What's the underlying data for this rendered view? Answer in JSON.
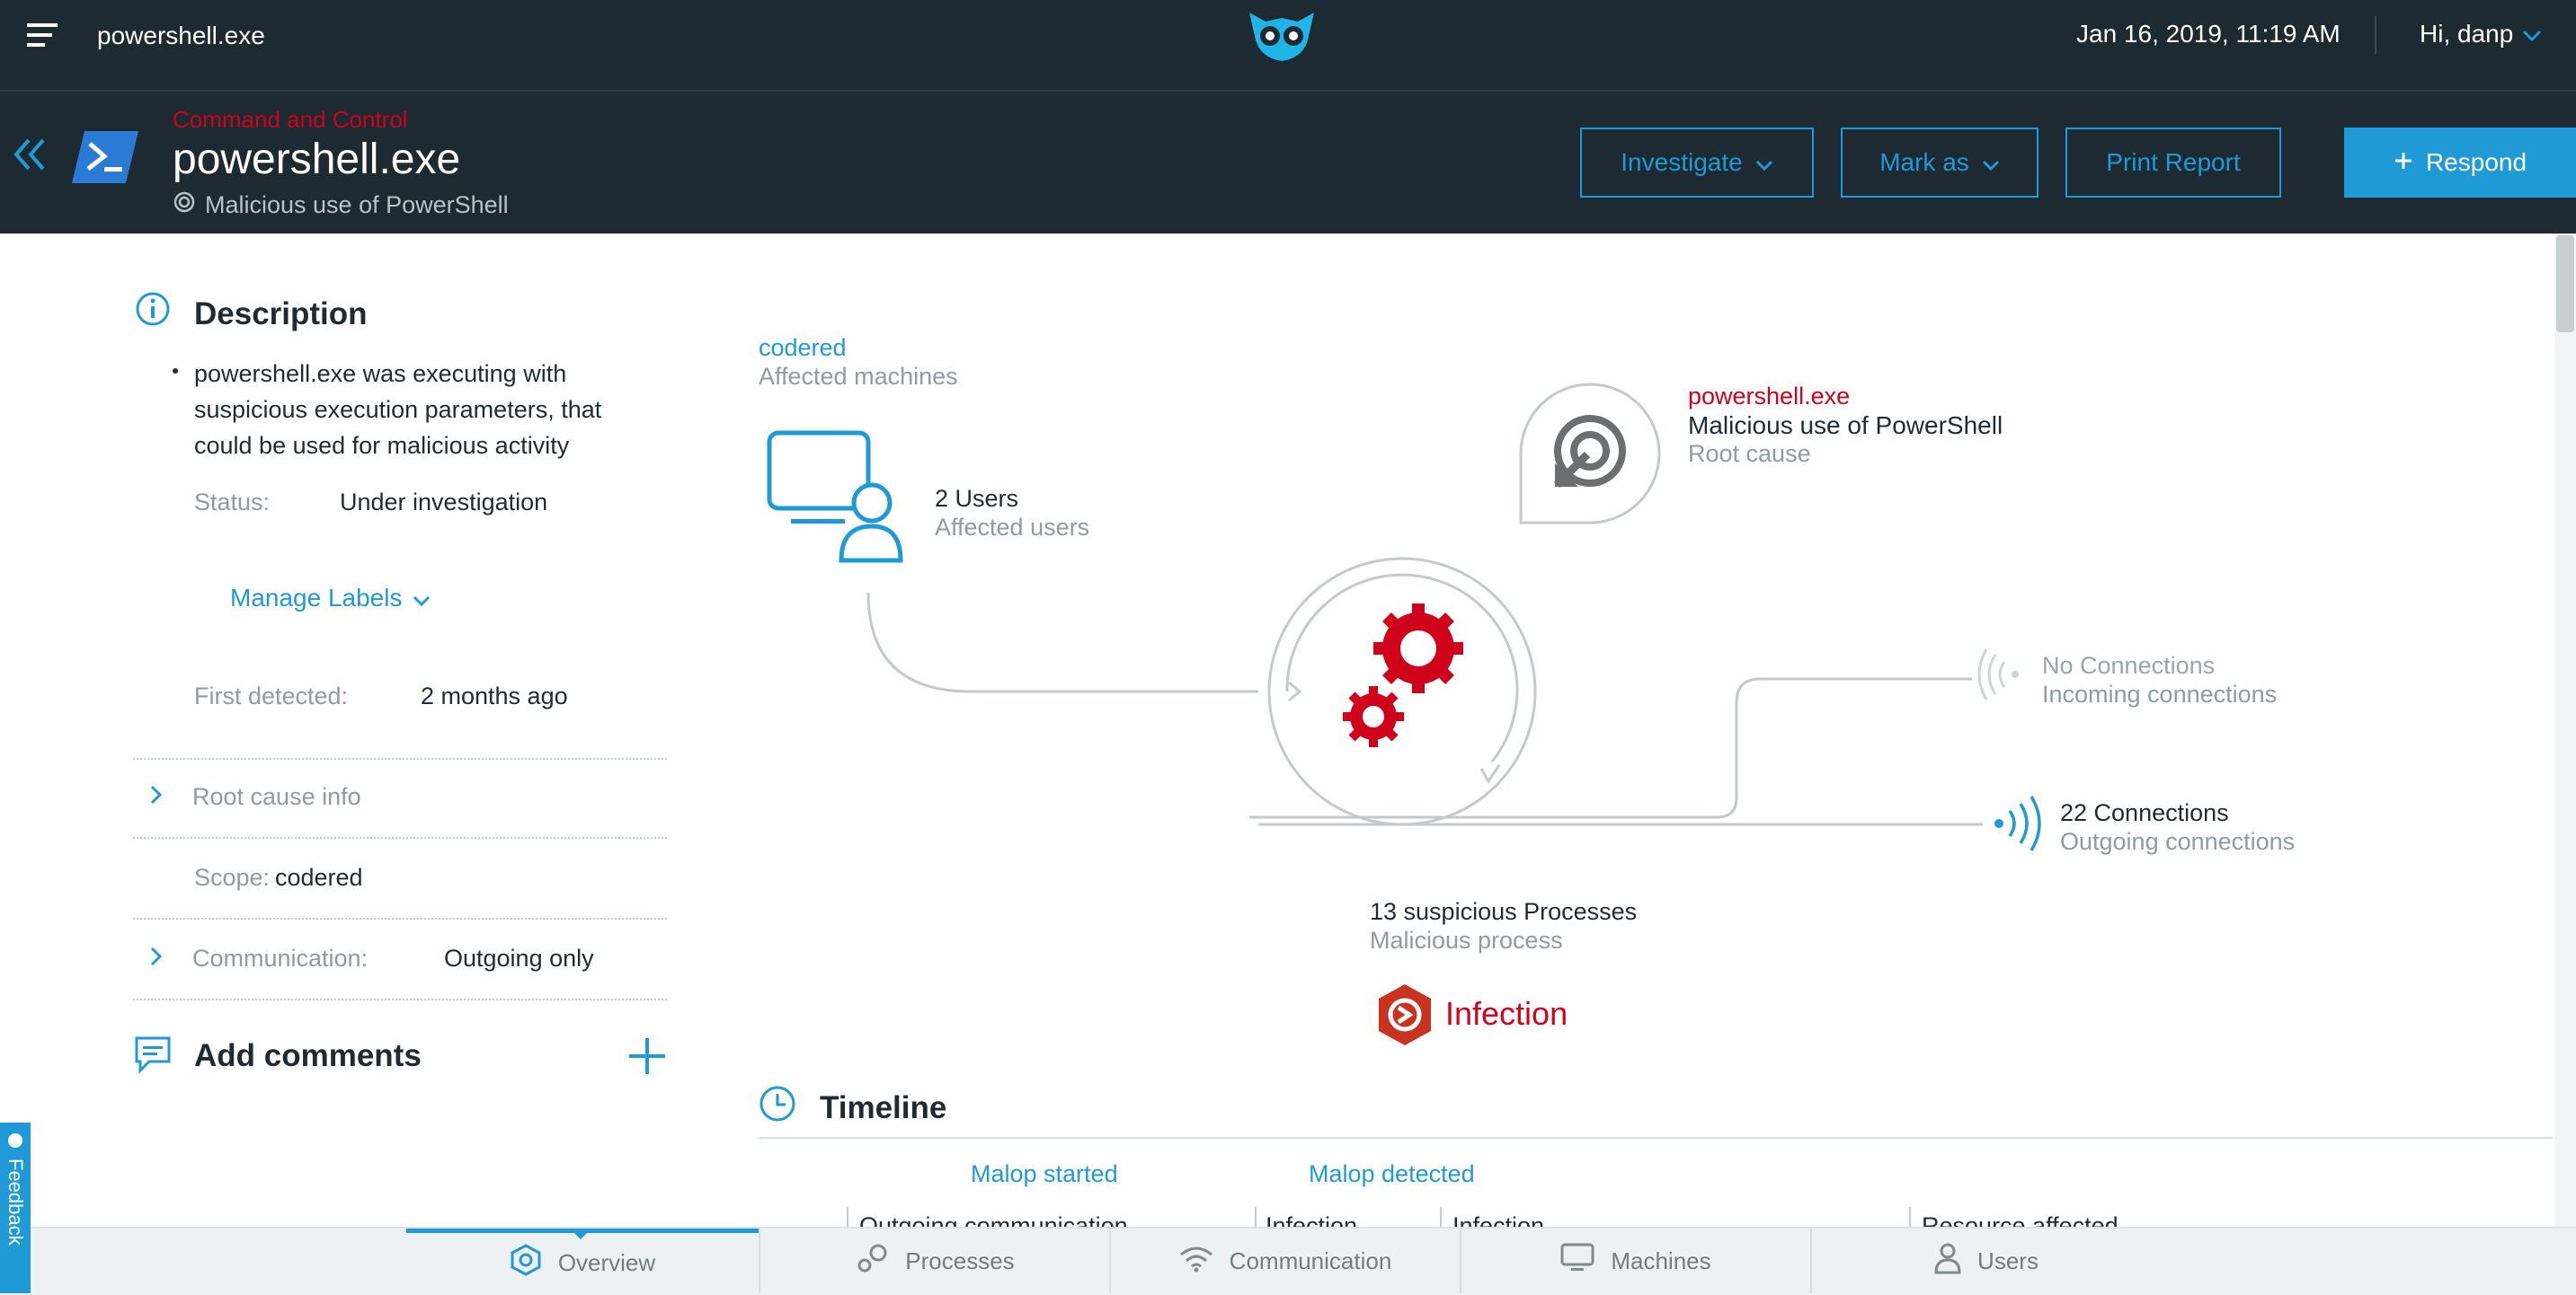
{
  "topbar": {
    "title": "powershell.exe",
    "datetime": "Jan 16, 2019, 11:19 AM",
    "greeting": "Hi, danp"
  },
  "header": {
    "category": "Command and Control",
    "title": "powershell.exe",
    "subtitle": "Malicious use of PowerShell",
    "buttons": {
      "investigate": "Investigate",
      "mark_as": "Mark as",
      "print_report": "Print Report",
      "respond": "Respond"
    }
  },
  "description": {
    "heading": "Description",
    "bullet": "powershell.exe was executing with suspicious execution parameters, that could be used for malicious activity",
    "status_label": "Status:",
    "status_value": "Under investigation",
    "manage_labels": "Manage Labels",
    "first_detected_label": "First detected:",
    "first_detected_value": "2 months ago",
    "root_cause_info": "Root cause info",
    "scope_label": "Scope:",
    "scope_value": "codered",
    "communication_label": "Communication:",
    "communication_value": "Outgoing only",
    "add_comments": "Add comments"
  },
  "diagram": {
    "machine_name": "codered",
    "machine_caption": "Affected machines",
    "users_count": "2 Users",
    "users_caption": "Affected users",
    "root_process": "powershell.exe",
    "root_description": "Malicious use of PowerShell",
    "root_caption": "Root cause",
    "incoming_count": "No Connections",
    "incoming_caption": "Incoming connections",
    "outgoing_count": "22 Connections",
    "outgoing_caption": "Outgoing connections",
    "processes_count": "13 suspicious Processes",
    "processes_caption": "Malicious process",
    "infection_label": "Infection"
  },
  "timeline": {
    "heading": "Timeline",
    "markers": [
      "Malop started",
      "Malop detected"
    ],
    "events": [
      "Outgoing communication",
      "Infection",
      "Infection",
      "Resource affected"
    ]
  },
  "tabs": [
    "Overview",
    "Processes",
    "Communication",
    "Machines",
    "Users"
  ],
  "feedback": "Feedback",
  "colors": {
    "accent": "#1f9ad6",
    "danger": "#d0021b",
    "header_bg": "#1e2a31"
  }
}
